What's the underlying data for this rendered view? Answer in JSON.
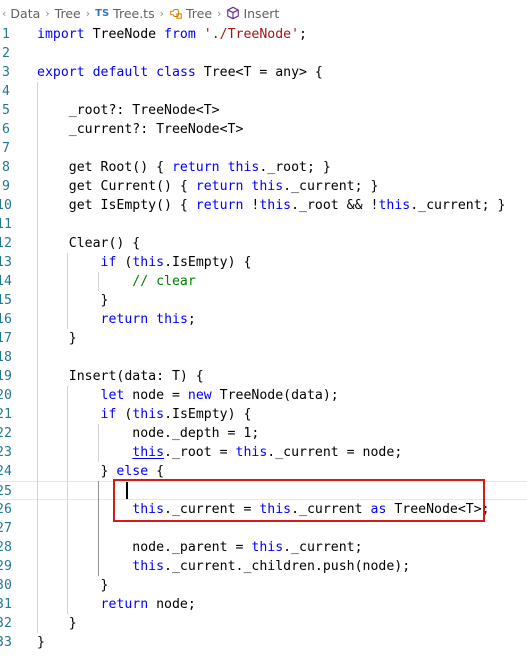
{
  "breadcrumb": {
    "items": [
      {
        "label": "Data",
        "kind": "folder"
      },
      {
        "label": "Tree",
        "kind": "folder"
      },
      {
        "label": "Tree.ts",
        "kind": "file",
        "badge": "TS"
      },
      {
        "label": "Tree",
        "kind": "class",
        "icon": "class-symbol-icon"
      },
      {
        "label": "Insert",
        "kind": "method",
        "icon": "method-symbol-icon"
      }
    ]
  },
  "editor": {
    "lines": [
      {
        "n": "1",
        "tokens": [
          [
            "kw",
            "import"
          ],
          [
            "plain",
            " TreeNode "
          ],
          [
            "kw",
            "from"
          ],
          [
            "plain",
            " "
          ],
          [
            "str",
            "'./TreeNode'"
          ],
          [
            "plain",
            ";"
          ]
        ]
      },
      {
        "n": "2",
        "tokens": []
      },
      {
        "n": "3",
        "tokens": [
          [
            "kw",
            "export"
          ],
          [
            "plain",
            " "
          ],
          [
            "kw",
            "default"
          ],
          [
            "plain",
            " "
          ],
          [
            "kw",
            "class"
          ],
          [
            "plain",
            " Tree<T = any> {"
          ]
        ]
      },
      {
        "n": "4",
        "tokens": []
      },
      {
        "n": "5",
        "tokens": [
          [
            "plain",
            "    _root?: TreeNode<T>"
          ]
        ]
      },
      {
        "n": "6",
        "tokens": [
          [
            "plain",
            "    _current?: TreeNode<T>"
          ]
        ]
      },
      {
        "n": "7",
        "tokens": []
      },
      {
        "n": "8",
        "tokens": [
          [
            "plain",
            "    get Root() { "
          ],
          [
            "kw",
            "return"
          ],
          [
            "plain",
            " "
          ],
          [
            "this",
            "this"
          ],
          [
            "plain",
            "._root; }"
          ]
        ]
      },
      {
        "n": "9",
        "tokens": [
          [
            "plain",
            "    get Current() { "
          ],
          [
            "kw",
            "return"
          ],
          [
            "plain",
            " "
          ],
          [
            "this",
            "this"
          ],
          [
            "plain",
            "._current; }"
          ]
        ]
      },
      {
        "n": "10",
        "tokens": [
          [
            "plain",
            "    get IsEmpty() { "
          ],
          [
            "kw",
            "return"
          ],
          [
            "plain",
            " !"
          ],
          [
            "this",
            "this"
          ],
          [
            "plain",
            "._root && !"
          ],
          [
            "this",
            "this"
          ],
          [
            "plain",
            "._current; }"
          ]
        ]
      },
      {
        "n": "11",
        "tokens": []
      },
      {
        "n": "12",
        "tokens": [
          [
            "plain",
            "    Clear() {"
          ]
        ]
      },
      {
        "n": "13",
        "tokens": [
          [
            "plain",
            "        "
          ],
          [
            "kw",
            "if"
          ],
          [
            "plain",
            " ("
          ],
          [
            "this",
            "this"
          ],
          [
            "plain",
            ".IsEmpty) {"
          ]
        ]
      },
      {
        "n": "14",
        "tokens": [
          [
            "plain",
            "            "
          ],
          [
            "comment",
            "// clear"
          ]
        ]
      },
      {
        "n": "15",
        "tokens": [
          [
            "plain",
            "        }"
          ]
        ]
      },
      {
        "n": "16",
        "tokens": [
          [
            "plain",
            "        "
          ],
          [
            "kw",
            "return"
          ],
          [
            "plain",
            " "
          ],
          [
            "this",
            "this"
          ],
          [
            "plain",
            ";"
          ]
        ]
      },
      {
        "n": "17",
        "tokens": [
          [
            "plain",
            "    }"
          ]
        ]
      },
      {
        "n": "18",
        "tokens": []
      },
      {
        "n": "19",
        "tokens": [
          [
            "plain",
            "    Insert(data: T) {"
          ]
        ]
      },
      {
        "n": "20",
        "tokens": [
          [
            "plain",
            "        "
          ],
          [
            "kw",
            "let"
          ],
          [
            "plain",
            " node = "
          ],
          [
            "kw",
            "new"
          ],
          [
            "plain",
            " TreeNode(data);"
          ]
        ]
      },
      {
        "n": "21",
        "tokens": [
          [
            "plain",
            "        "
          ],
          [
            "kw",
            "if"
          ],
          [
            "plain",
            " ("
          ],
          [
            "this",
            "this"
          ],
          [
            "plain",
            ".IsEmpty) {"
          ]
        ]
      },
      {
        "n": "22",
        "tokens": [
          [
            "plain",
            "            node._depth = 1;"
          ]
        ]
      },
      {
        "n": "23",
        "tokens": [
          [
            "plain",
            "            "
          ],
          [
            "this-u",
            "this"
          ],
          [
            "plain",
            "._root = "
          ],
          [
            "this",
            "this"
          ],
          [
            "plain",
            "._current = node;"
          ]
        ]
      },
      {
        "n": "24",
        "tokens": [
          [
            "plain",
            "        } "
          ],
          [
            "kw",
            "else"
          ],
          [
            "plain",
            " {"
          ]
        ]
      },
      {
        "n": "25",
        "tokens": []
      },
      {
        "n": "26",
        "tokens": [
          [
            "plain",
            "            "
          ],
          [
            "this",
            "this"
          ],
          [
            "plain",
            "._current = "
          ],
          [
            "this",
            "this"
          ],
          [
            "plain",
            "._current "
          ],
          [
            "kw",
            "as"
          ],
          [
            "plain",
            " TreeNode<T>;"
          ]
        ]
      },
      {
        "n": "27",
        "tokens": []
      },
      {
        "n": "28",
        "tokens": [
          [
            "plain",
            "            node._parent = "
          ],
          [
            "this",
            "this"
          ],
          [
            "plain",
            "._current;"
          ]
        ]
      },
      {
        "n": "29",
        "tokens": [
          [
            "plain",
            "            "
          ],
          [
            "this",
            "this"
          ],
          [
            "plain",
            "._current._children.push(node);"
          ]
        ]
      },
      {
        "n": "30",
        "tokens": [
          [
            "plain",
            "        }"
          ]
        ]
      },
      {
        "n": "31",
        "tokens": [
          [
            "plain",
            "        "
          ],
          [
            "kw",
            "return"
          ],
          [
            "plain",
            " node;"
          ]
        ]
      },
      {
        "n": "32",
        "tokens": [
          [
            "plain",
            "    }"
          ]
        ]
      },
      {
        "n": "33",
        "tokens": [
          [
            "plain",
            "}"
          ]
        ]
      }
    ]
  },
  "colors": {
    "keyword": "#0000ff",
    "string": "#a31515",
    "comment": "#008000",
    "line_number": "#237893",
    "annotation_box": "#d11a1a",
    "typescript_badge": "#3178c6"
  }
}
